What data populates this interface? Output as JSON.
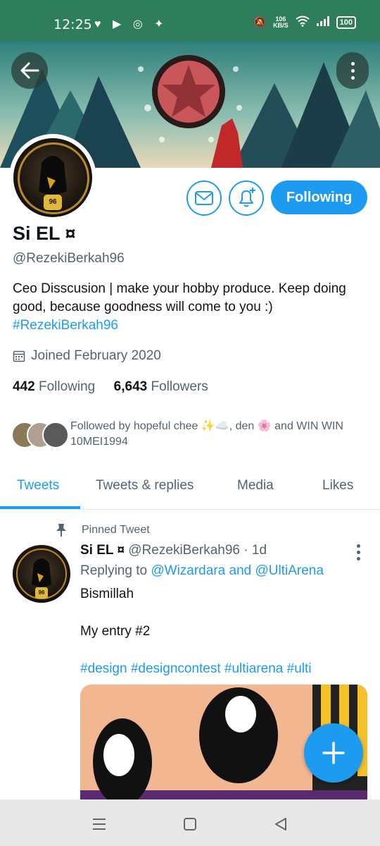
{
  "status_bar": {
    "time": "12:25",
    "net_speed": "106",
    "net_unit": "KB/S",
    "battery": "100"
  },
  "profile": {
    "name": "Si EL ¤",
    "handle": "@RezekiBerkah96",
    "follow_button": "Following",
    "bio_line1": "Ceo Disscusion | make your hobby produce.  Keep doing good, because goodness will come to you :)",
    "bio_tag": "#RezekiBerkah96",
    "joined": "Joined February 2020",
    "following_count": "442",
    "following_label": "Following",
    "followers_count": "6,643",
    "followers_label": "Followers",
    "followed_by": "Followed by hopeful chee ✨☁️, den 🌸 and WIN WIN 10MEI1994",
    "avatar_badge": "96"
  },
  "tabs": [
    "Tweets",
    "Tweets & replies",
    "Media",
    "Likes"
  ],
  "pinned_tweet": {
    "pinned_label": "Pinned Tweet",
    "author_name": "Si EL ¤",
    "author_handle": "@RezekiBerkah96",
    "time": "· 1d",
    "replying_prefix": "Replying to",
    "mention1": "@Wizardara",
    "and_word": "and",
    "mention2": "@UltiArena",
    "line1": "Bismillah",
    "line2": "My entry #2",
    "hashtags": "#design #designcontest #ultiarena #ulti"
  },
  "colors": {
    "accent": "#1d9bf0",
    "status_bar": "#2e7d5b",
    "secondary_text": "#536471"
  }
}
